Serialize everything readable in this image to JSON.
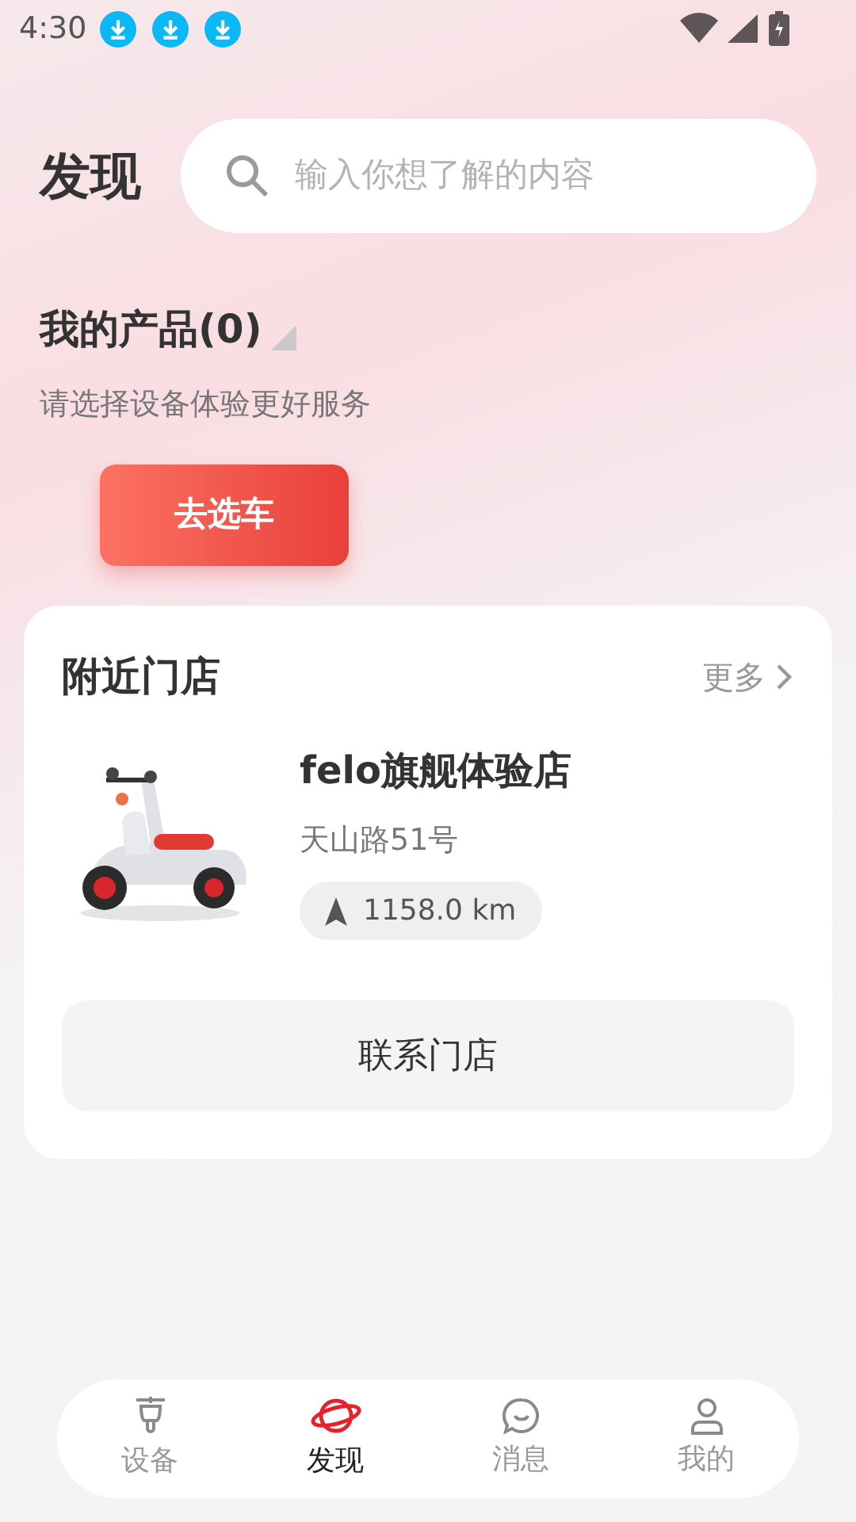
{
  "status_bar": {
    "time": "4:30",
    "notifications": [
      {
        "kind": "download"
      },
      {
        "kind": "download"
      },
      {
        "kind": "download"
      }
    ]
  },
  "header": {
    "title": "发现",
    "search": {
      "placeholder": "输入你想了解的内容"
    }
  },
  "my_products": {
    "title": "我的产品(0)",
    "subtitle": "请选择设备体验更好服务",
    "button": "去选车"
  },
  "nearby_stores": {
    "title": "附近门店",
    "more": "更多",
    "store": {
      "name": "felo旗舰体验店",
      "address": "天山路51号",
      "distance": "1158.0 km"
    },
    "contact_button": "联系门店"
  },
  "bottom_nav": [
    {
      "kind": "device",
      "label": "设备",
      "selected": false
    },
    {
      "kind": "discover",
      "label": "发现",
      "selected": true
    },
    {
      "kind": "message",
      "label": "消息",
      "selected": false
    },
    {
      "kind": "profile",
      "label": "我的",
      "selected": false
    }
  ]
}
